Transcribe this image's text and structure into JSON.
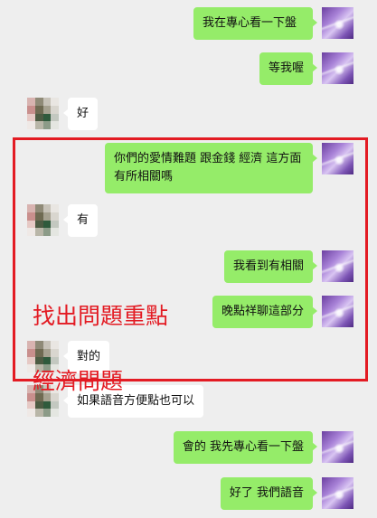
{
  "messages": [
    {
      "side": "out",
      "text": "我在專心看一下盤"
    },
    {
      "side": "out",
      "text": "等我喔"
    },
    {
      "side": "in",
      "text": "好"
    },
    {
      "side": "out",
      "text": "你們的愛情難題 跟金錢 經濟 這方面 有所相關嗎"
    },
    {
      "side": "in",
      "text": "有"
    },
    {
      "side": "out",
      "text": "我看到有相關"
    },
    {
      "side": "out",
      "text": "晚點祥聊這部分"
    },
    {
      "side": "in",
      "text": "對的"
    },
    {
      "side": "in",
      "text": "如果語音方便點也可以"
    },
    {
      "side": "out",
      "text": "會的 我先專心看一下盤"
    },
    {
      "side": "out",
      "text": "好了 我們語音"
    }
  ],
  "annotation": {
    "line1": "找出問題重點",
    "line2": "經濟問題",
    "color": "#e31b23"
  },
  "colors": {
    "background": "#eeeeee",
    "outgoing_bubble": "#95ec69",
    "incoming_bubble": "#ffffff"
  }
}
